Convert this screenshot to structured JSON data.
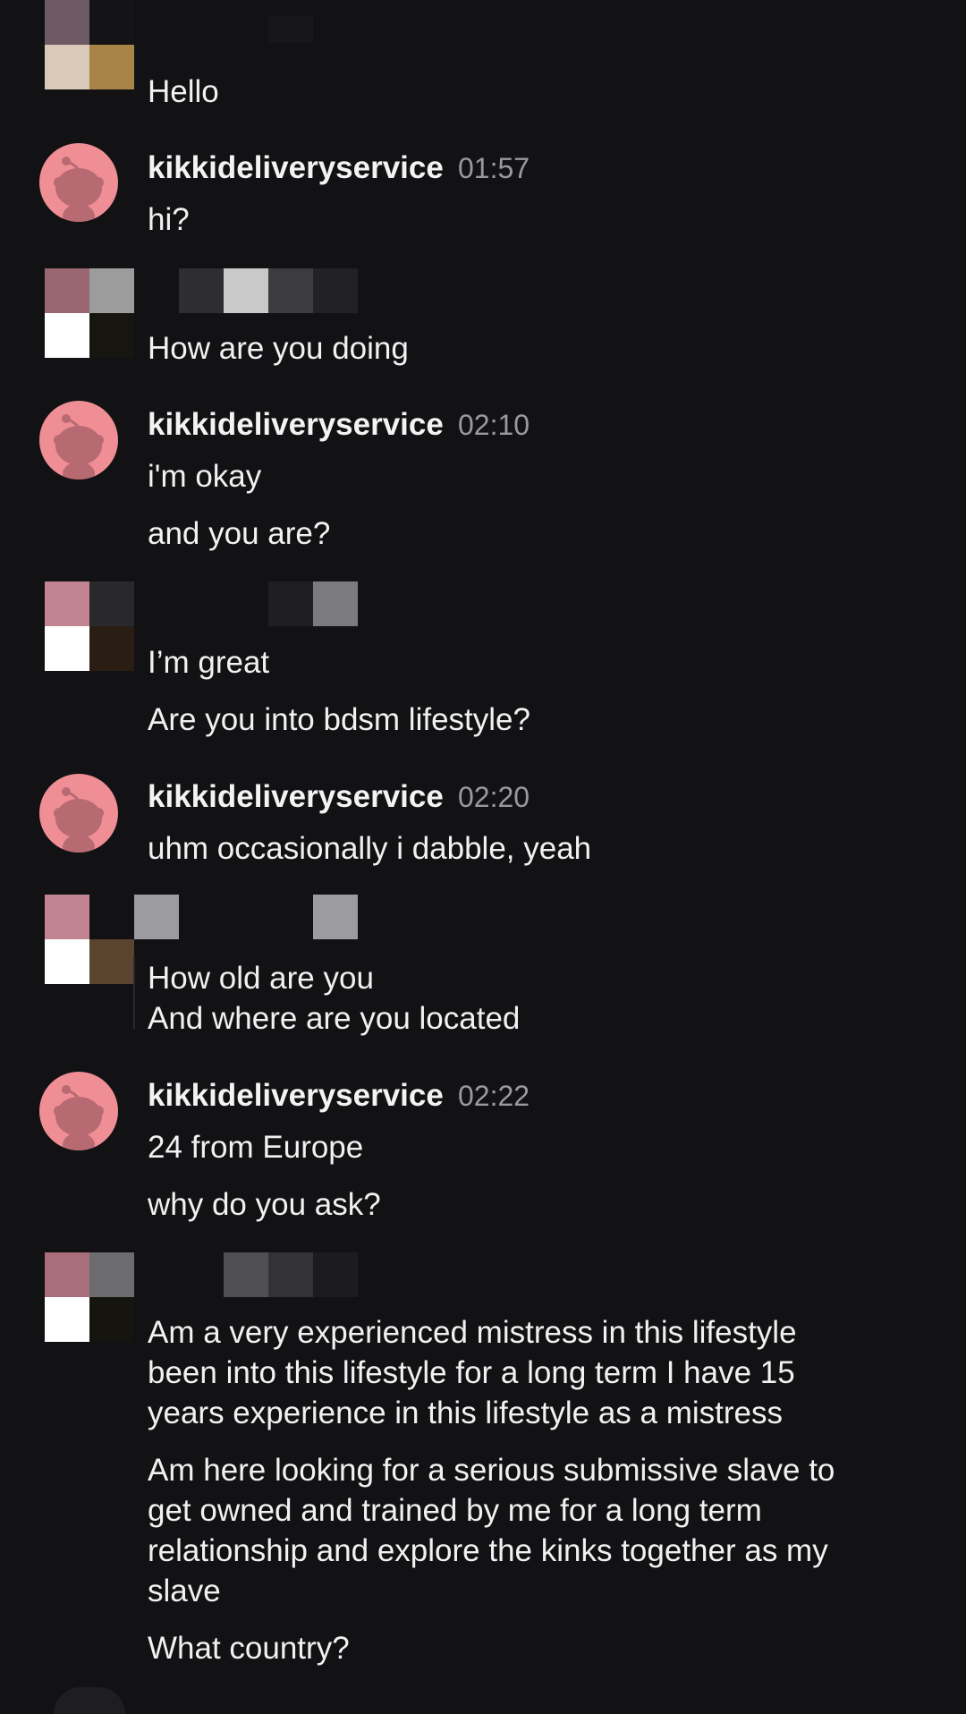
{
  "colors": {
    "background": "#121214",
    "text": "#f1f1f1",
    "timestamp": "#9a9a9e",
    "avatar_pink": "#f08e96"
  },
  "bot_user": {
    "username": "kikkideliveryservice",
    "avatar_icon": "reddit-snoo-icon"
  },
  "messages": {
    "m0": {
      "lines": [
        "Hello"
      ]
    },
    "m1": {
      "time": "01:57",
      "lines": [
        "hi?"
      ]
    },
    "m2": {
      "lines": [
        "How are you doing"
      ]
    },
    "m3": {
      "time": "02:10",
      "lines": [
        "i'm okay",
        "and you are?"
      ]
    },
    "m4": {
      "lines": [
        "I’m great",
        "Are you into bdsm lifestyle?"
      ]
    },
    "m5": {
      "time": "02:20",
      "lines": [
        "uhm occasionally i dabble, yeah"
      ]
    },
    "m6": {
      "lines": [
        "How old are you",
        "And where are you located"
      ]
    },
    "m7": {
      "time": "02:22",
      "lines": [
        "24 from Europe",
        "why do you ask?"
      ]
    },
    "m8": {
      "lines": [
        "Am a very experienced mistress in this lifestyle",
        "been into this lifestyle for a long term I have 15",
        "years experience in this lifestyle as a mistress",
        "Am here looking for a serious submissive slave to",
        "get owned and trained by me for a long term",
        "relationship and explore the kinks together as my",
        "slave",
        "What country?"
      ]
    }
  }
}
